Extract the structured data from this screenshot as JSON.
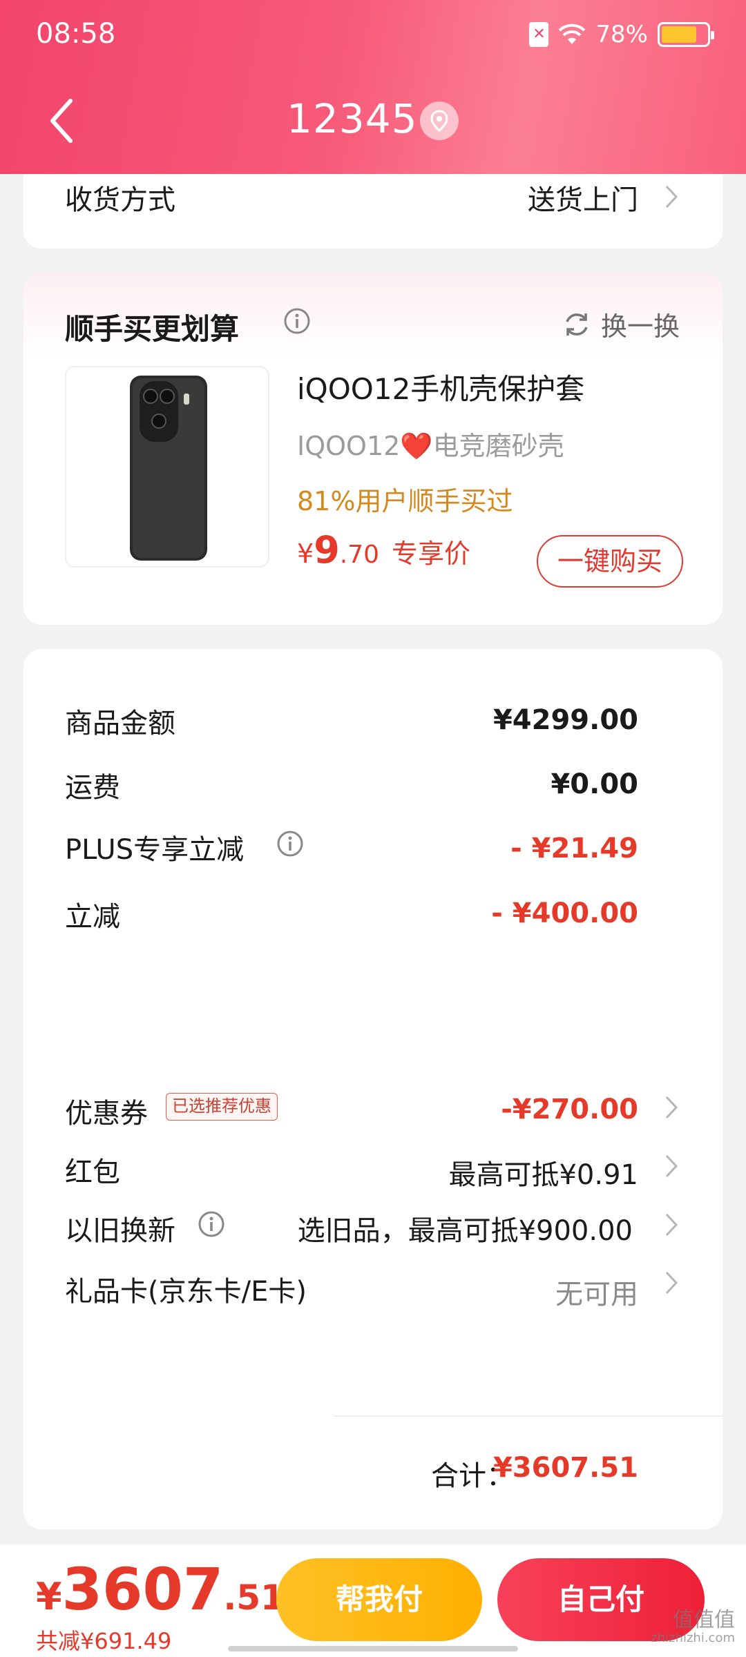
{
  "status_bar": {
    "time": "08:58",
    "battery": "78%",
    "battery_level": 0.78
  },
  "header": {
    "title": "12345",
    "back_icon": "chevron-left-icon",
    "location_icon": "location-pin-icon"
  },
  "delivery": {
    "label": "收货方式",
    "value": "送货上门"
  },
  "recommend": {
    "title": "顺手买更划算",
    "refresh_label": "换一换",
    "product": {
      "name": "iQOO12手机壳保护套",
      "subtitle_prefix": "IQOO12",
      "subtitle_heart": "❤️",
      "subtitle_suffix": "电竞磨砂壳",
      "bought_text": "81%用户顺手买过",
      "price_currency": "¥",
      "price_int": "9",
      "price_dec": ".70",
      "price_tag": "专享价",
      "buy_label": "一键购买"
    }
  },
  "summary": {
    "rows": [
      {
        "label": "商品金额",
        "value": "¥4299.00"
      },
      {
        "label": "运费",
        "value": "¥0.00"
      },
      {
        "label": "PLUS专享立减",
        "value": "- ¥21.49"
      },
      {
        "label": "立减",
        "value": "- ¥400.00"
      },
      {
        "label": "优惠券",
        "badge": "已选推荐优惠",
        "value": "-¥270.00"
      },
      {
        "label": "红包",
        "value": "最高可抵¥0.91"
      },
      {
        "label": "以旧换新",
        "value": "选旧品，最高可抵¥900.00"
      },
      {
        "label": "礼品卡(京东卡/E卡)",
        "value": "无可用"
      }
    ],
    "total_label": "合计：",
    "total_value": "¥3607.51"
  },
  "bottom_bar": {
    "price_currency": "¥",
    "price_int": "3607",
    "price_dec": ".51",
    "saved_text": "共减¥691.49",
    "help_pay_label": "帮我付",
    "self_pay_label": "自己付"
  },
  "watermark": {
    "main": "值值值",
    "sub": "zhizhizhi.com"
  },
  "colors": {
    "accent_red": "#e53a2a",
    "header_pink": "#f2446c",
    "help_yellow": "#ffb000",
    "bought_orange": "#d4891e"
  }
}
